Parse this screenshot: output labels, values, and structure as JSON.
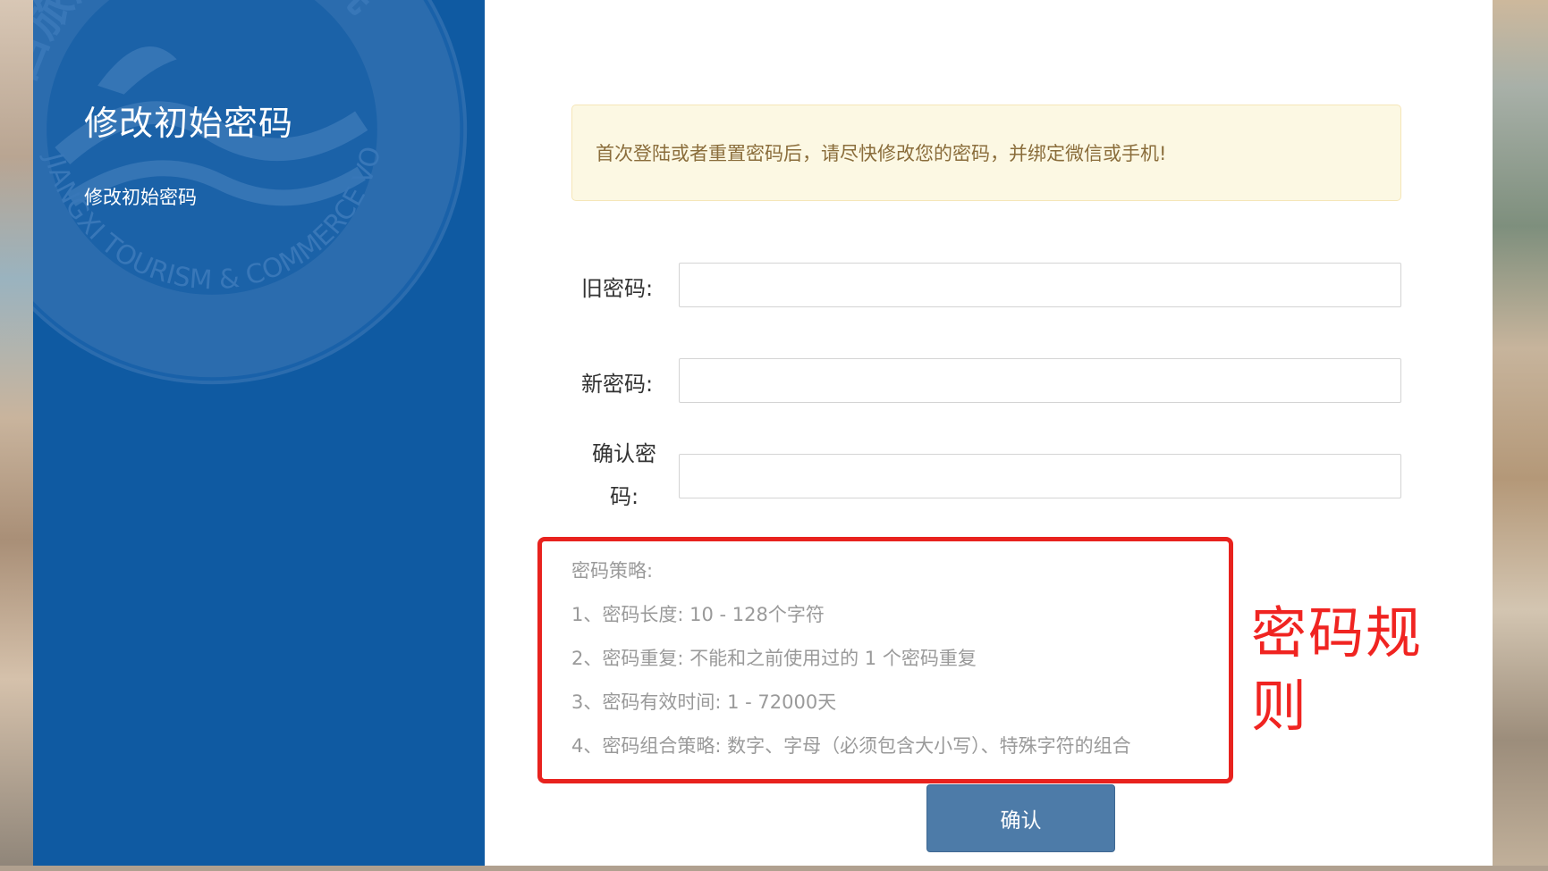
{
  "sidebar": {
    "title": "修改初始密码",
    "subtitle": "修改初始密码",
    "logo_text": {
      "chinese": "江西旅游商贸职业学院",
      "english": "JIANGXI TOURISM & COMMERCE VOCATIONAL COLLEGE"
    },
    "colors": {
      "background": "#0f5aa2",
      "seal": "#2f6fb0"
    }
  },
  "notice": {
    "text": "首次登陆或者重置密码后，请尽快修改您的密码，并绑定微信或手机!"
  },
  "form": {
    "old_password_label": "旧密码:",
    "new_password_label": "新密码:",
    "confirm_password_label_line1": "确认密",
    "confirm_password_label_line2": "码:",
    "old_password_value": "",
    "new_password_value": "",
    "confirm_password_value": ""
  },
  "policy": {
    "heading": "密码策略:",
    "rules": [
      "1、密码长度: 10 - 128个字符",
      "2、密码重复: 不能和之前使用过的 1 个密码重复",
      "3、密码有效时间: 1 - 72000天",
      "4、密码组合策略: 数字、字母（必须包含大小写）、特殊字符的组合"
    ],
    "highlight_color": "#e8221e"
  },
  "annotation": {
    "text": "密码规则",
    "color": "#f02421"
  },
  "buttons": {
    "confirm_label": "确认"
  }
}
